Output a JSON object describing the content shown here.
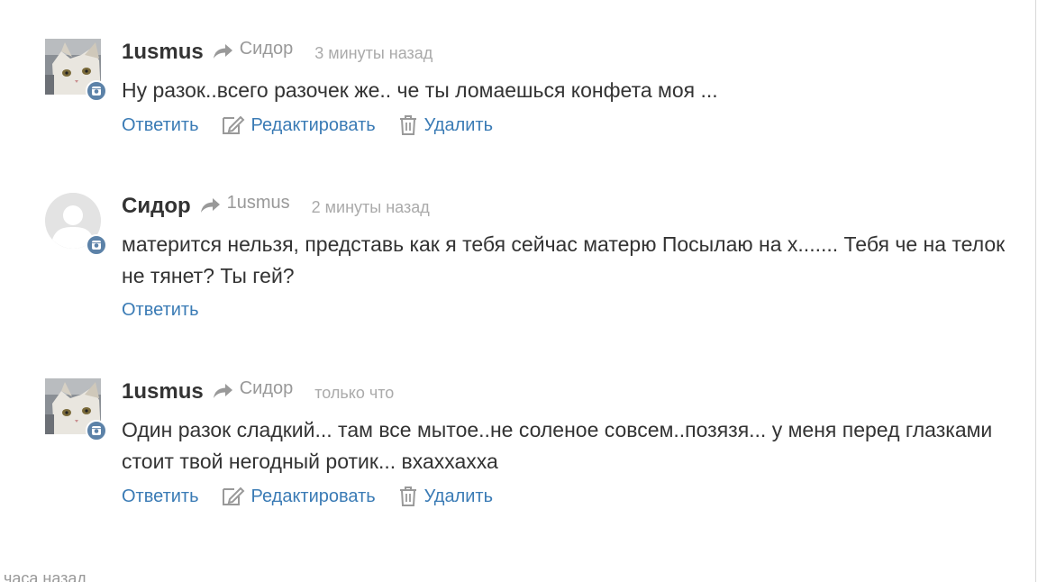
{
  "comments": [
    {
      "author": "1usmus",
      "reply_to": "Сидор",
      "time": "3 минуты назад",
      "text": "Ну разок..всего разочек же.. че ты ломаешься конфета моя ...",
      "actions": {
        "reply": "Ответить",
        "edit": "Редактировать",
        "delete": "Удалить"
      }
    },
    {
      "author": "Сидор",
      "reply_to": "1usmus",
      "time": "2 минуты назад",
      "text": "матерится нельзя, представь как я тебя сейчас матерю Посылаю на х....... Тебя че на телок не тянет? Ты гей?",
      "actions": {
        "reply": "Ответить"
      }
    },
    {
      "author": "1usmus",
      "reply_to": "Сидор",
      "time": "только что",
      "text": "Один разок сладкий... там все мытое..не соленое совсем..позязя... у меня перед глазками стоит твой негодный ротик... вхаххахха",
      "actions": {
        "reply": "Ответить",
        "edit": "Редактировать",
        "delete": "Удалить"
      }
    }
  ],
  "cut_off_text": "часа назад",
  "colors": {
    "link": "#3a7bb5",
    "author": "#333333",
    "muted": "#999999",
    "badge": "#5c82a8"
  },
  "icons": {
    "reply_arrow": "share-arrow-icon",
    "edit": "edit-pencil-icon",
    "delete": "trash-icon",
    "badge": "instagram-icon"
  }
}
